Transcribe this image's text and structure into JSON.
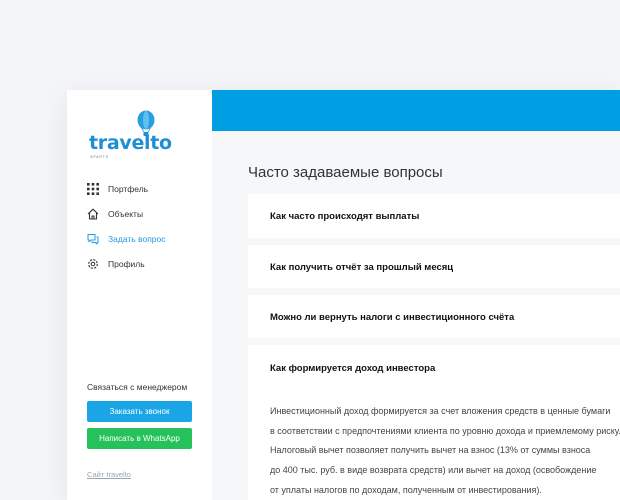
{
  "logo": {
    "word": "travelto",
    "sub": "APARTS"
  },
  "sidebar": {
    "items": [
      {
        "label": "Портфель",
        "icon": "grid-icon"
      },
      {
        "label": "Объекты",
        "icon": "home-icon"
      },
      {
        "label": "Задать вопрос",
        "icon": "chat-icon",
        "active": true
      },
      {
        "label": "Профиль",
        "icon": "gear-icon"
      }
    ],
    "contact_label": "Связаться с менеджером",
    "call_button": "Заказать звонок",
    "whatsapp_button": "Написать в WhatsApp",
    "site_link": "Сайт travelto"
  },
  "main": {
    "title": "Часто задаваемые вопросы",
    "faq": [
      {
        "question": "Как часто происходят выплаты"
      },
      {
        "question": "Как получить отчёт за прошлый месяц"
      },
      {
        "question": "Можно ли вернуть налоги с инвестиционного счёта"
      },
      {
        "question": "Как формируется доход инвестора",
        "answer_lines": [
          "Инвестиционный доход формируется за счет вложения средств в ценные бумаги",
          "в соответствии с предпочтениями клиента по уровню дохода и приемлемому риску.",
          "Налоговый вычет позволяет получить вычет на взнос (13% от суммы взноса",
          "до 400 тыс. руб. в виде возврата средств) или вычет на доход (освобождение",
          "от уплаты налогов по доходам, полученным от инвестирования)."
        ]
      }
    ]
  },
  "colors": {
    "accent": "#009ee3",
    "call_button": "#1aa6e6",
    "whatsapp_button": "#25c25c",
    "logo": "#1e8fd4"
  }
}
